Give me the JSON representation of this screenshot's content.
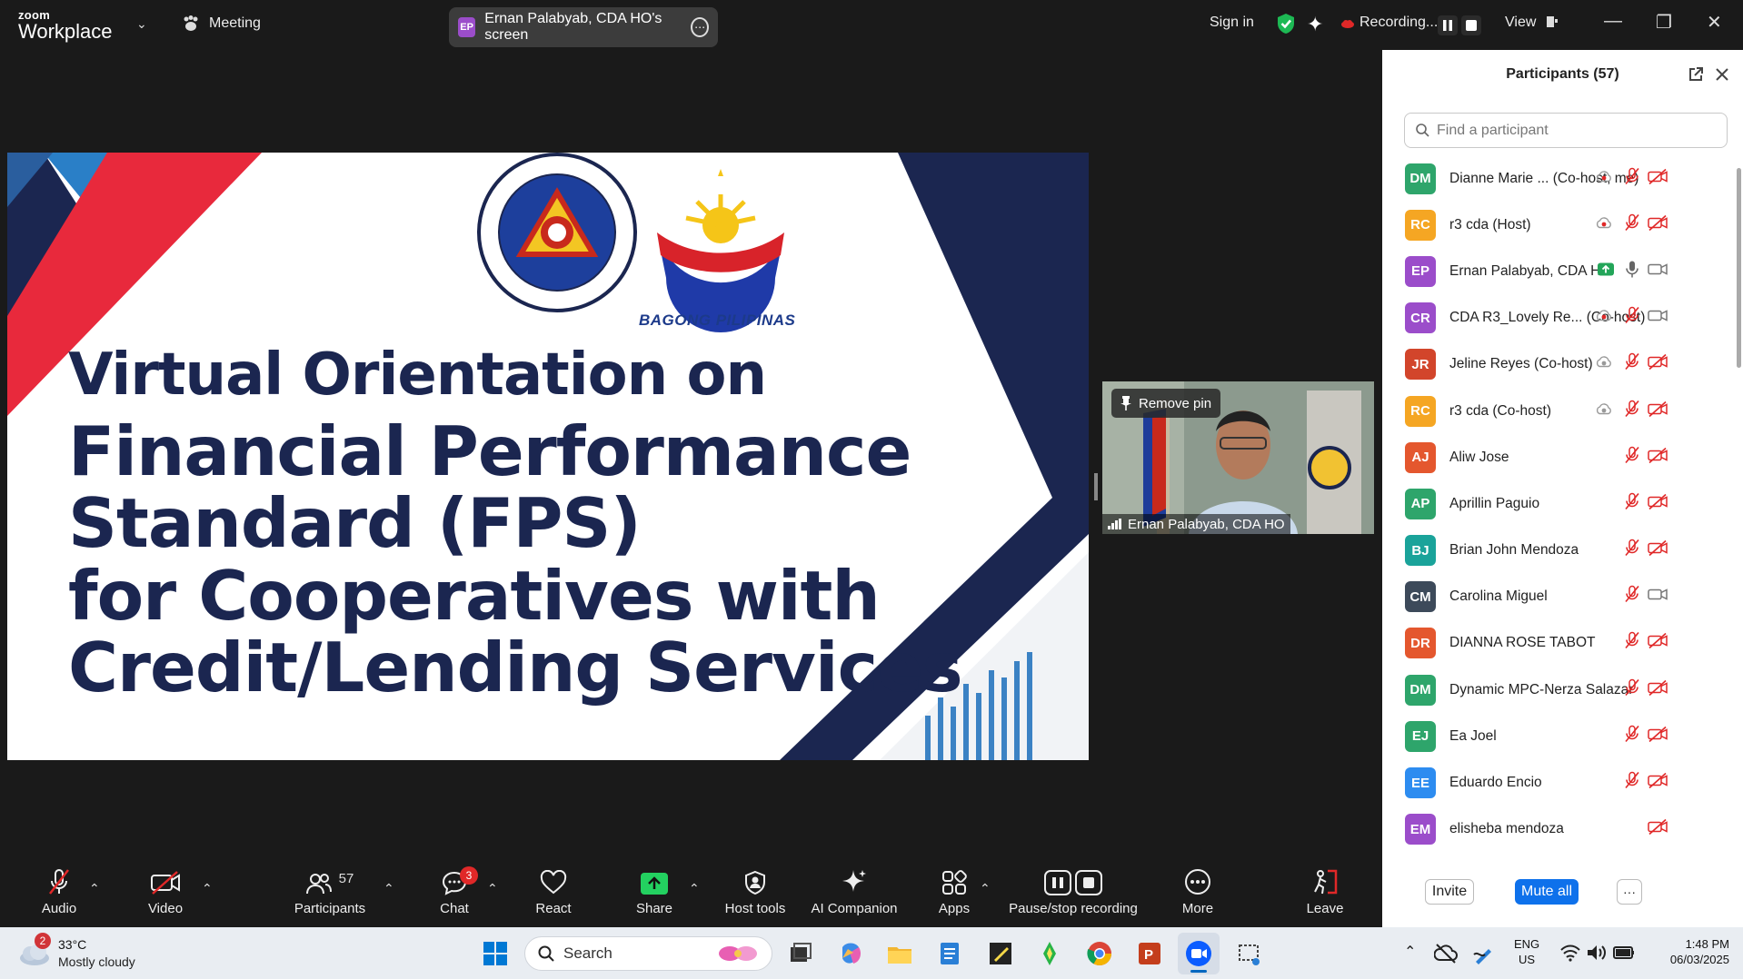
{
  "app": {
    "logo_top": "zoom",
    "logo_bottom": "Workplace",
    "meeting_label": "Meeting",
    "share_pill": {
      "initials": "EP",
      "label": "Ernan Palabyab, CDA HO's screen"
    },
    "sign_in": "Sign in",
    "recording_label": "Recording...",
    "view_label": "View"
  },
  "slide": {
    "line1": "Virtual Orientation on",
    "line2": "Financial Performance",
    "line3": "Standard (FPS)",
    "line4": "for Cooperatives with",
    "line5": "Credit/Lending Services",
    "seal_text": "COOPERATIVE DEVELOPMENT AUTHORITY",
    "seal_bottom": "PHILIPPINES",
    "brand": "BAGONG PILIPINAS"
  },
  "video": {
    "remove_pin": "Remove pin",
    "name": "Ernan Palabyab, CDA HO"
  },
  "participants": {
    "title": "Participants (57)",
    "search_placeholder": "Find a participant",
    "list": [
      {
        "initials": "DM",
        "color": "#2ea56b",
        "name": "Dianne Marie ...  (Co-host, me)",
        "rec": true,
        "mic": "muted",
        "cam": "off"
      },
      {
        "initials": "RC",
        "color": "#f5a623",
        "name": "r3 cda (Host)",
        "rec": true,
        "mic": "muted",
        "cam": "off"
      },
      {
        "initials": "EP",
        "color": "#9b4dca",
        "name": "Ernan Palabyab, CDA HO",
        "share": true,
        "mic": "on",
        "cam": "on"
      },
      {
        "initials": "CR",
        "color": "#9b4dca",
        "name": "CDA R3_Lovely Re...  (Co-host)",
        "rec": true,
        "mic": "muted",
        "cam": "on"
      },
      {
        "initials": "JR",
        "color": "#d2452b",
        "name": "Jeline Reyes (Co-host)",
        "rec2": true,
        "mic": "muted",
        "cam": "off"
      },
      {
        "initials": "RC",
        "color": "#f5a623",
        "name": "r3 cda (Co-host)",
        "rec2": true,
        "mic": "muted",
        "cam": "off"
      },
      {
        "initials": "AJ",
        "color": "#e4572e",
        "name": "Aliw Jose",
        "mic": "muted",
        "cam": "off"
      },
      {
        "initials": "AP",
        "color": "#2ea56b",
        "name": "Aprillin Paguio",
        "mic": "muted",
        "cam": "off"
      },
      {
        "initials": "BJ",
        "color": "#1aa39a",
        "name": "Brian John Mendoza",
        "mic": "muted",
        "cam": "off"
      },
      {
        "initials": "CM",
        "color": "#3d4a5a",
        "name": "Carolina Miguel",
        "mic": "muted",
        "cam": "on"
      },
      {
        "initials": "DR",
        "color": "#e4572e",
        "name": "DIANNA ROSE TABOT",
        "mic": "muted",
        "cam": "off"
      },
      {
        "initials": "DM",
        "color": "#2ea56b",
        "name": "Dynamic MPC-Nerza Salazar",
        "mic": "muted",
        "cam": "off"
      },
      {
        "initials": "EJ",
        "color": "#2ea56b",
        "name": "Ea Joel",
        "mic": "muted",
        "cam": "off"
      },
      {
        "initials": "EE",
        "color": "#2d8cf0",
        "name": "Eduardo Encio",
        "mic": "muted",
        "cam": "off"
      },
      {
        "initials": "EM",
        "color": "#9b4dca",
        "name": "elisheba mendoza",
        "mic": "none",
        "cam": "off"
      }
    ],
    "invite": "Invite",
    "mute_all": "Mute all",
    "more": "···"
  },
  "toolbar": {
    "audio": "Audio",
    "video": "Video",
    "participants": "Participants",
    "participants_count": "57",
    "chat": "Chat",
    "chat_badge": "3",
    "react": "React",
    "share": "Share",
    "host_tools": "Host tools",
    "ai_companion": "AI Companion",
    "apps": "Apps",
    "pause_stop": "Pause/stop recording",
    "more": "More",
    "leave": "Leave"
  },
  "taskbar": {
    "weather_badge": "2",
    "temp": "33°C",
    "condition": "Mostly cloudy",
    "search": "Search",
    "lang1": "ENG",
    "lang2": "US",
    "time": "1:48 PM",
    "date": "06/03/2025"
  }
}
